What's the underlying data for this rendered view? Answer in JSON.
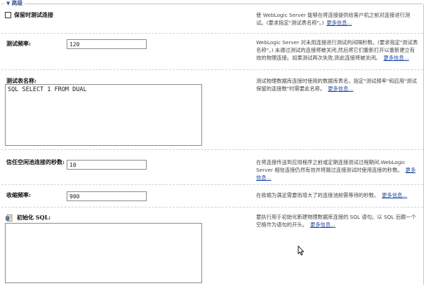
{
  "section": {
    "title": "高级"
  },
  "test_reserved": {
    "label": "保留时测试连接",
    "help": "使 WebLogic Server 能够在将连接提供给客户机之前对连接进行测试。(要求指定\"测试表名称\"。)",
    "more": "更多信息..."
  },
  "test_frequency": {
    "label": "测试频率:",
    "value": "120",
    "help": "WebLogic Server 对未用连接进行测试的间隔秒数。(要求指定\"测试表名称\"。) 未通过测试的连接将被关闭,然后将它们重新打开以重新建立有效的物理连接。如果测试再次失败,则此连接将被关闭。",
    "more": "更多信息..."
  },
  "test_table": {
    "label": "测试表名称:",
    "value": "SQL SELECT 1 FROM DUAL",
    "help": "测试物理数据库连接时使用的数据库表名。指定\"测试频率\"和启用\"测试保留的连接数\"时需要此名称。",
    "more": "更多信息..."
  },
  "idle_trust": {
    "label": "信任空闲池连接的秒数:",
    "value": "10",
    "help": "在将连接传送到应用程序之前或定期连接测试过程期间,WebLogic Server 相信连接仍然有效并将跳过连接测试时使用连接的秒数。",
    "more": "更多信息..."
  },
  "shrink_frequency": {
    "label": "收缩频率:",
    "value": "900",
    "help": "在收缩为满足需要而增大了的连接池前需等待的秒数。",
    "more": "更多信息..."
  },
  "init_sql": {
    "label": "初始化 SQL:",
    "value": "",
    "help": "要执行用于初始化新建物理数据库连接的 SQL 语句。以 SQL 后跟一个空格作为语句的开头。",
    "more": "更多信息..."
  },
  "icons": {
    "section_toggle": "chevron-down-icon",
    "sql": "sql-document-icon",
    "cursor": "mouse-pointer-icon"
  }
}
